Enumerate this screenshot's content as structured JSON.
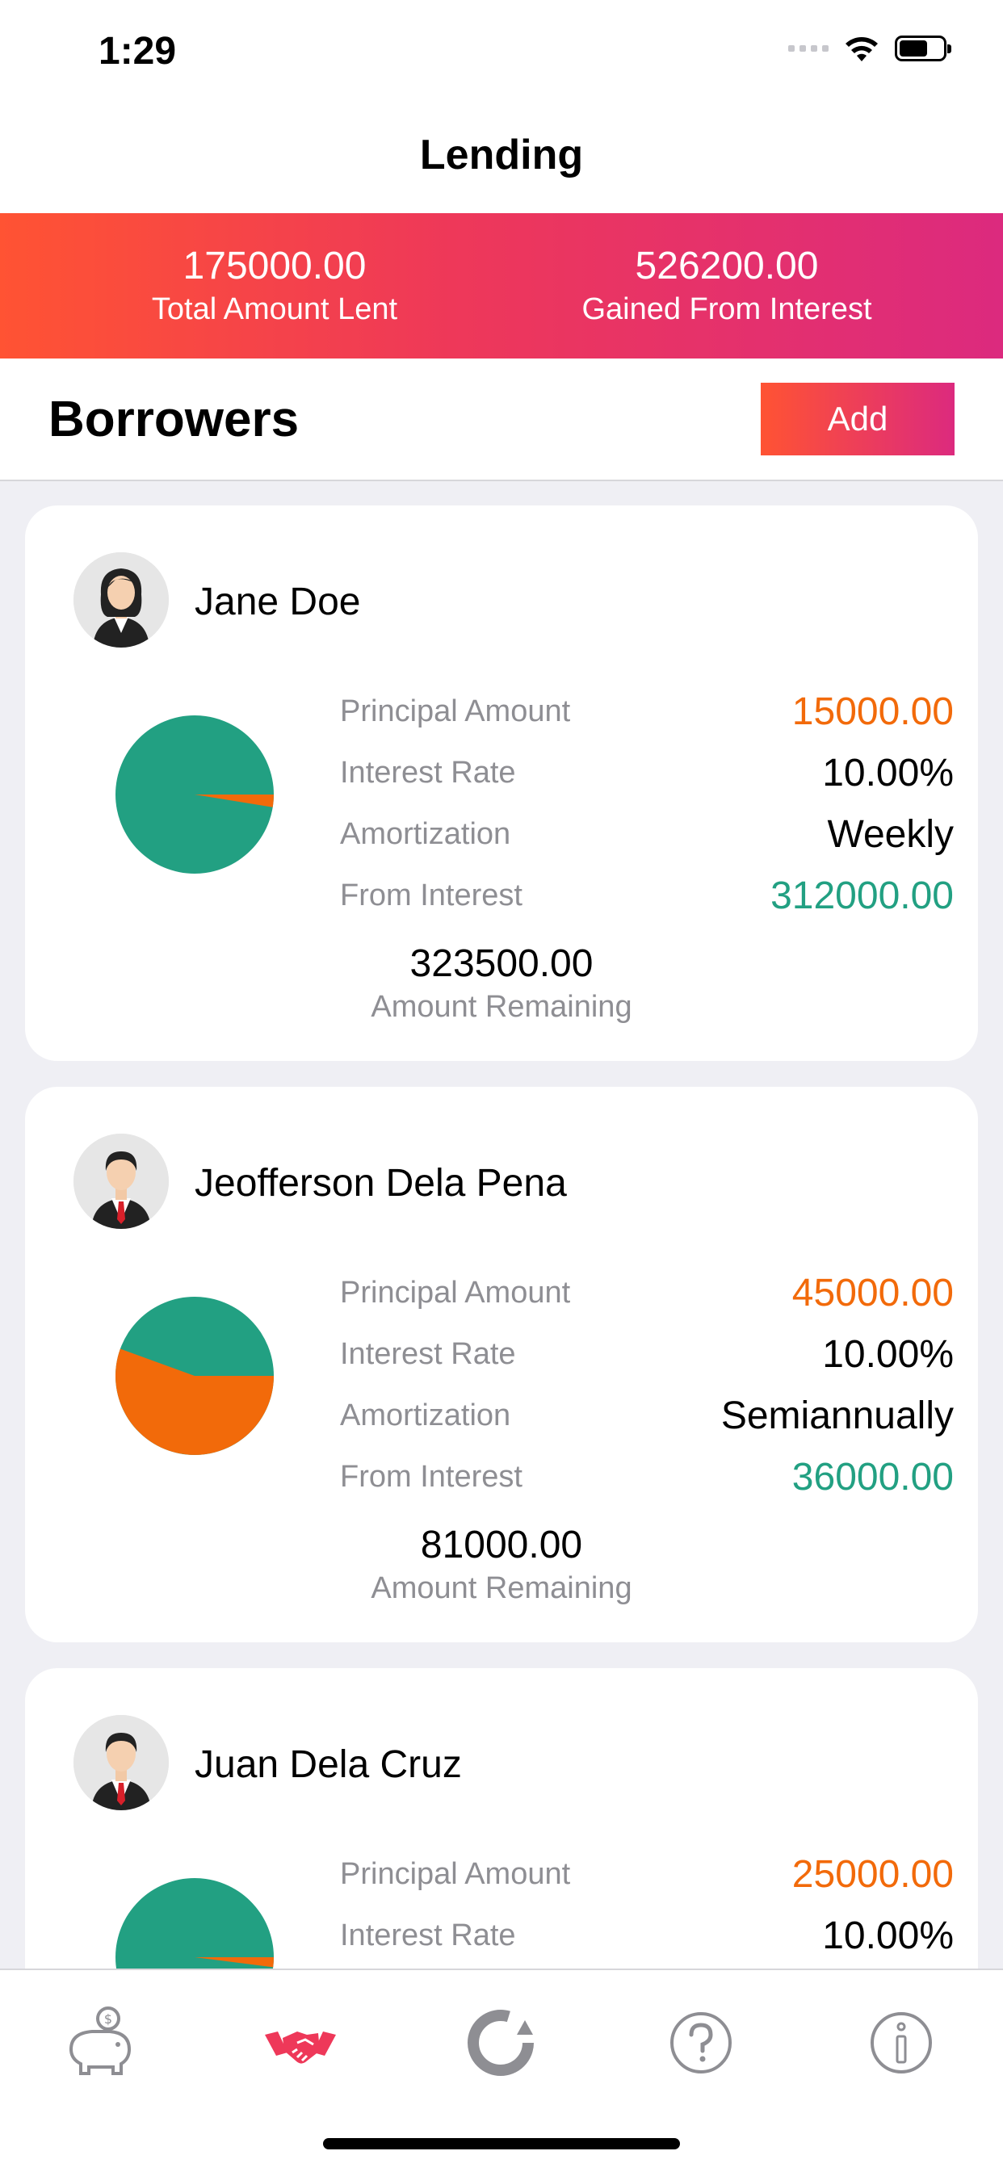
{
  "status_bar": {
    "time": "1:29"
  },
  "nav": {
    "title": "Lending"
  },
  "summary": {
    "total_amount_lent": "175000.00",
    "total_amount_lent_label": "Total Amount Lent",
    "gained_from_interest": "526200.00",
    "gained_from_interest_label": "Gained From Interest"
  },
  "header": {
    "title": "Borrowers",
    "add_label": "Add"
  },
  "labels": {
    "principal": "Principal Amount",
    "interest_rate": "Interest Rate",
    "amortization": "Amortization",
    "from_interest": "From Interest",
    "amount_remaining": "Amount Remaining"
  },
  "colors": {
    "accent_start": "#FF5333",
    "accent_end": "#DC2A7E",
    "principal": "#F26A0A",
    "interest": "#22A082"
  },
  "borrowers": [
    {
      "name": "Jane Doe",
      "avatar": "female-avatar-icon",
      "principal": "15000.00",
      "interest_rate": "10.00%",
      "amortization": "Weekly",
      "from_interest": "312000.00",
      "amount_remaining": "323500.00"
    },
    {
      "name": "Jeofferson Dela Pena",
      "avatar": "male-avatar-icon",
      "principal": "45000.00",
      "interest_rate": "10.00%",
      "amortization": "Semiannually",
      "from_interest": "36000.00",
      "amount_remaining": "81000.00"
    },
    {
      "name": "Juan Dela Cruz",
      "avatar": "male-avatar-icon",
      "principal": "25000.00",
      "interest_rate": "10.00%"
    }
  ],
  "tabs": [
    {
      "icon": "piggy-bank-icon",
      "active": false
    },
    {
      "icon": "handshake-icon",
      "active": true
    },
    {
      "icon": "loan-cycle-icon",
      "active": false
    },
    {
      "icon": "help-icon",
      "active": false
    },
    {
      "icon": "info-icon",
      "active": false
    }
  ]
}
